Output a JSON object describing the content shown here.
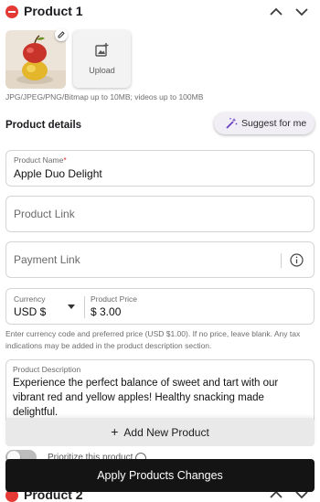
{
  "product": {
    "title": "Product 1",
    "image_hint": "JPG/JPEG/PNG/Bitmap up to 10MB; videos up to 100MB",
    "upload_label": "Upload"
  },
  "details": {
    "section_title": "Product details",
    "suggest_label": "Suggest for me",
    "name_label": "Product Name",
    "name_required_mark": "*",
    "name_value": "Apple Duo Delight",
    "link_placeholder": "Product Link",
    "payment_placeholder": "Payment Link",
    "currency_label": "Currency",
    "currency_value": "USD $",
    "price_label": "Product Price",
    "price_value": "$ 3.00",
    "price_help": "Enter currency code and preferred price (USD $1.00). If no price, leave blank. Any tax indications may be added in the product description section.",
    "description_label": "Product Description",
    "description_value": "Experience the perfect balance of sweet and tart with our vibrant red and yellow apples! Healthy snacking made delightful."
  },
  "footer": {
    "toggle_label": "Prioritize this product",
    "add_label": "Add New Product",
    "apply_label": "Apply Products Changes",
    "next_title": "Product 2"
  },
  "colors": {
    "remove": "#e53935",
    "suggest_icon": "#6a3fc1",
    "apply_bg": "#141414"
  }
}
